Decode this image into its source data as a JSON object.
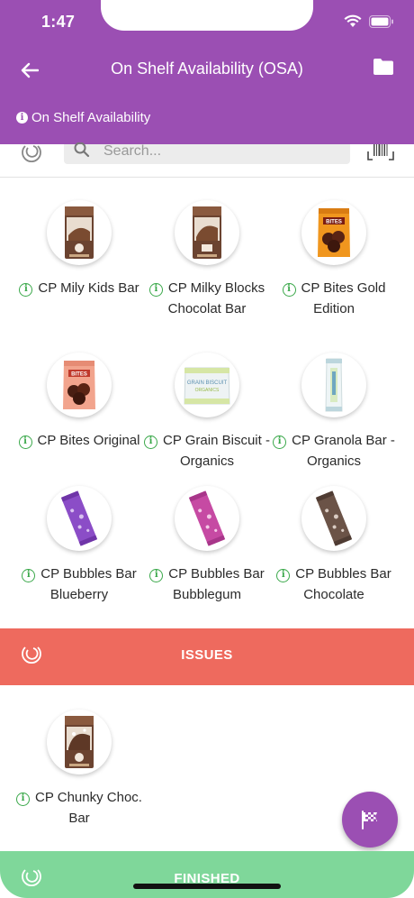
{
  "status_bar": {
    "time": "1:47"
  },
  "header": {
    "title": "On Shelf Availability (OSA)",
    "subtitle": "On Shelf Availability",
    "info_glyph": "i",
    "back_icon": "arrow-left-icon",
    "folder_icon": "folder-icon",
    "color": "#9b4fb3"
  },
  "search": {
    "placeholder": "Search..."
  },
  "products": [
    {
      "name": "CP Mily Kids Bar",
      "pack": "chocolate-box"
    },
    {
      "name": "CP Milky Blocks Chocolat Bar",
      "pack": "chocolate-box"
    },
    {
      "name": "CP Bites Gold Edition",
      "pack": "bites-gold"
    },
    {
      "name": "CP Bites Original",
      "pack": "bites-original"
    },
    {
      "name": "CP Grain Biscuit - Organics",
      "pack": "grain-biscuit"
    },
    {
      "name": "CP Granola Bar - Organics",
      "pack": "granola-bar"
    },
    {
      "name": "CP Bubbles Bar Blueberry",
      "pack": "bubbles-purple"
    },
    {
      "name": "CP Bubbles Bar Bubblegum",
      "pack": "bubbles-pink"
    },
    {
      "name": "CP Bubbles Bar Chocolate",
      "pack": "bubbles-brown"
    }
  ],
  "issues": {
    "label": "ISSUES",
    "color": "#ee6a5e",
    "products": [
      {
        "name": "CP Chunky Choc. Bar",
        "pack": "chocolate-box"
      }
    ]
  },
  "finished": {
    "label": "FINISHED",
    "color": "#7fd79a"
  },
  "fab": {
    "icon": "flag-icon"
  }
}
